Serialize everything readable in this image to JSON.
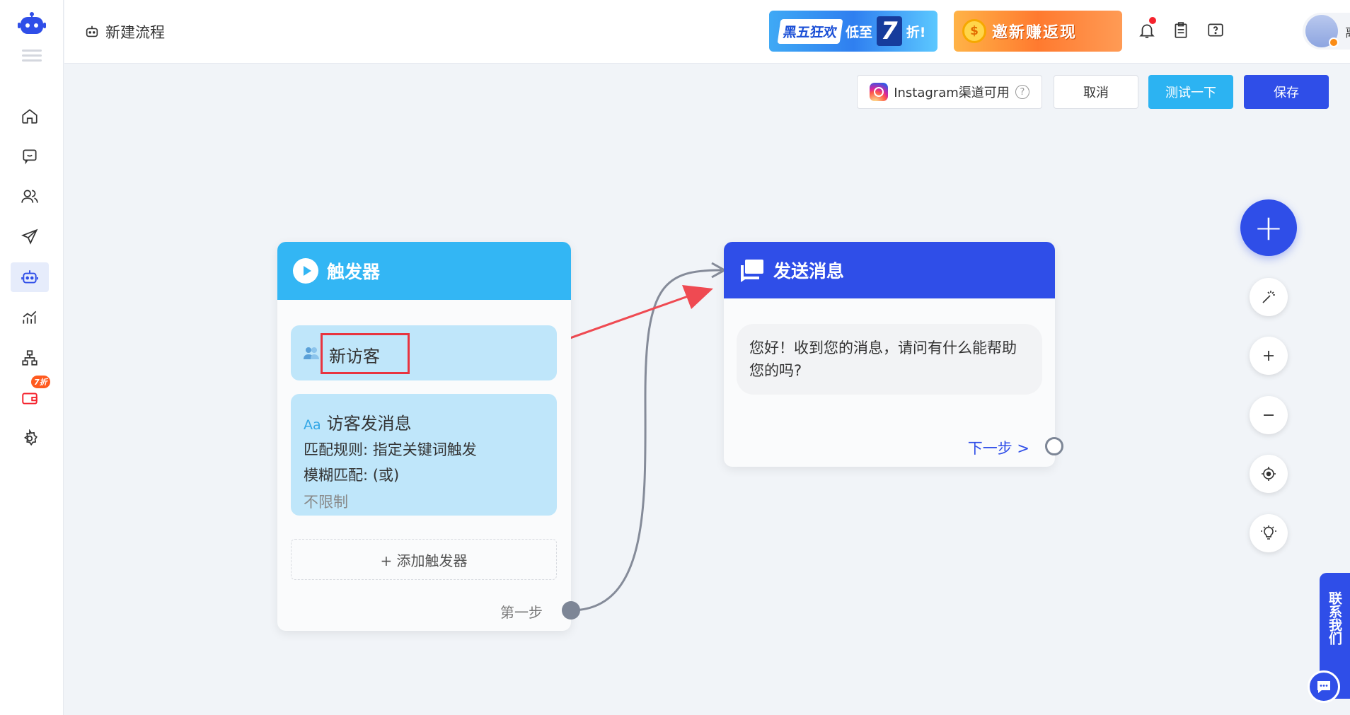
{
  "header": {
    "page_title": "新建流程",
    "promo_blackfriday": {
      "tag": "黑五狂欢",
      "text": "低至",
      "number": "7",
      "suffix": "折!"
    },
    "promo_invite": {
      "coin": "$",
      "text": "邀新赚返现"
    },
    "user": {
      "status": "离线"
    }
  },
  "sidebar": {
    "discount_badge": "7折"
  },
  "toolbar": {
    "instagram_label": "Instagram渠道可用",
    "help_glyph": "?",
    "cancel_label": "取消",
    "test_label": "测试一下",
    "save_label": "保存"
  },
  "trigger_card": {
    "title": "触发器",
    "item_visitor": "新访客",
    "item_message": {
      "title": "访客发消息",
      "icon_text": "Aa",
      "rule": "匹配规则: 指定关键词触发",
      "fuzzy": "模糊匹配: (或)",
      "limit": "不限制"
    },
    "add_trigger": "+ 添加触发器",
    "step_label": "第一步"
  },
  "message_card": {
    "title": "发送消息",
    "bubble_text": "您好！收到您的消息，请问有什么能帮助您的吗?",
    "next_step": "下一步 >"
  },
  "tools": {
    "fab": "+"
  },
  "contact": {
    "label": "联系我们"
  },
  "colors": {
    "primary": "#2f4ee8",
    "trigger": "#33b6f4",
    "trigger_item": "#bfe6fa",
    "annotation": "#e8343f"
  }
}
